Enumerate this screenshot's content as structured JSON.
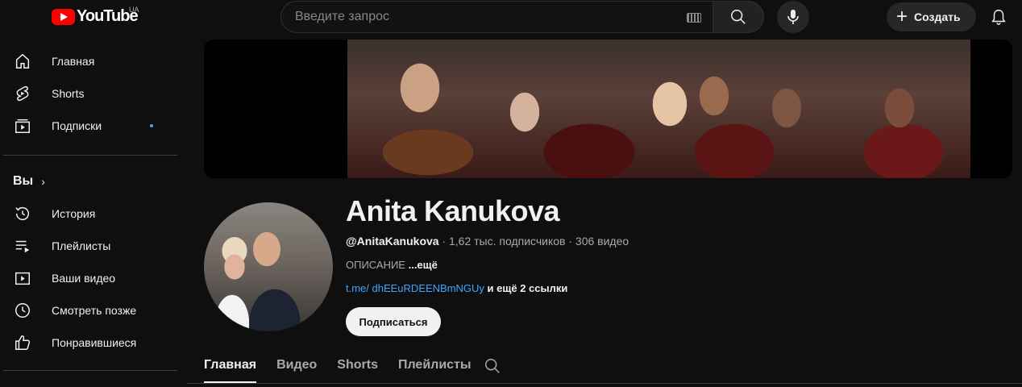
{
  "topbar": {
    "logo_text": "YouTube",
    "country_code": "UA",
    "search_placeholder": "Введите запрос",
    "create_label": "Создать"
  },
  "sidebar": {
    "main_items": [
      {
        "label": "Главная",
        "icon": "home-icon"
      },
      {
        "label": "Shorts",
        "icon": "shorts-icon"
      },
      {
        "label": "Подписки",
        "icon": "subscriptions-icon",
        "badge_dot": true
      }
    ],
    "you_section": {
      "title": "Вы",
      "items": [
        {
          "label": "История",
          "icon": "history-icon"
        },
        {
          "label": "Плейлисты",
          "icon": "playlists-icon"
        },
        {
          "label": "Ваши видео",
          "icon": "your-videos-icon"
        },
        {
          "label": "Смотреть позже",
          "icon": "watch-later-icon"
        },
        {
          "label": "Понравившиеся",
          "icon": "liked-icon"
        }
      ]
    }
  },
  "channel": {
    "name": "Anita Kanukova",
    "handle": "@AnitaKanukova",
    "stats": " · 1,62 тыс. подписчиков · 306 видео",
    "description": "ОПИСАНИЕ ",
    "description_more": "...ещё",
    "link": "t.me/ dhEEuRDEENBmNGUy",
    "links_more": " и ещё 2 ссылки",
    "subscribe_label": "Подписаться"
  },
  "tabs": [
    {
      "label": "Главная",
      "active": true
    },
    {
      "label": "Видео",
      "active": false
    },
    {
      "label": "Shorts",
      "active": false
    },
    {
      "label": "Плейлисты",
      "active": false
    }
  ],
  "colors": {
    "background": "#0f0f0f",
    "accent_red": "#ff0000",
    "link_blue": "#3ea6ff"
  }
}
